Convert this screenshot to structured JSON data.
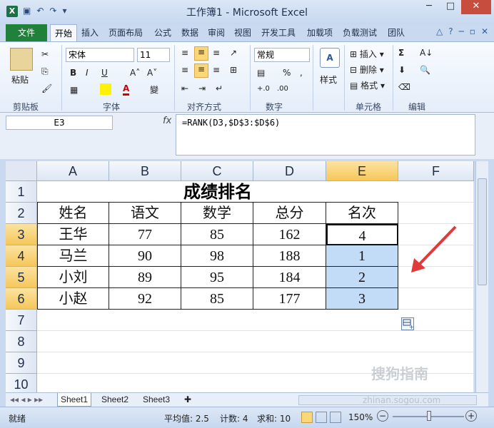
{
  "window": {
    "title": "工作簿1 - Microsoft Excel",
    "app_icon": "X",
    "minimize": "─",
    "restore": "□",
    "close": "✕"
  },
  "qat": {
    "save_icon": "💾",
    "undo_icon": "↶",
    "redo_icon": "↷"
  },
  "ribbon_tabs": [
    "文件",
    "开始",
    "插入",
    "页面布局",
    "公式",
    "数据",
    "审阅",
    "视图",
    "开发工具",
    "加载项",
    "负载测试",
    "团队"
  ],
  "ribbon": {
    "clipboard": {
      "paste": "粘贴",
      "label": "剪贴板"
    },
    "font": {
      "name": "宋体",
      "size": "11",
      "bold": "B",
      "italic": "I",
      "underline": "U",
      "label": "字体"
    },
    "alignment": {
      "label": "对齐方式"
    },
    "number": {
      "format": "常规",
      "percent": "%",
      "comma": ",",
      "label": "数字"
    },
    "styles": {
      "label": "样式"
    },
    "cells": {
      "insert": "插入",
      "delete": "删除",
      "format": "格式",
      "label": "单元格"
    },
    "editing": {
      "sum": "Σ",
      "label": "编辑"
    }
  },
  "formula_bar": {
    "name_box": "E3",
    "fx": "fx",
    "formula": "=RANK(D3,$D$3:$D$6)"
  },
  "sheet": {
    "columns": [
      "A",
      "B",
      "C",
      "D",
      "E",
      "F"
    ],
    "selected_column": "E",
    "rows": [
      "1",
      "2",
      "3",
      "4",
      "5",
      "6",
      "7",
      "8",
      "9",
      "10"
    ],
    "selected_rows": [
      "3",
      "4",
      "5",
      "6"
    ],
    "title": "成绩排名",
    "headers": [
      "姓名",
      "语文",
      "数学",
      "总分",
      "名次"
    ],
    "data": [
      [
        "王华",
        "77",
        "85",
        "162",
        "4"
      ],
      [
        "马兰",
        "90",
        "98",
        "188",
        "1"
      ],
      [
        "小刘",
        "89",
        "95",
        "184",
        "2"
      ],
      [
        "小赵",
        "92",
        "85",
        "177",
        "3"
      ]
    ]
  },
  "sheet_tabs": [
    "Sheet1",
    "Sheet2",
    "Sheet3"
  ],
  "status": {
    "mode": "就绪",
    "average": "平均值: 2.5",
    "count": "计数: 4",
    "sum": "求和: 10",
    "zoom": "150%"
  },
  "watermark": {
    "text": "搜狗指南",
    "url": "zhinan.sogou.com"
  },
  "colors": {
    "selection": "#c2dbf6",
    "header_selected": "#f6c75a",
    "file_tab": "#20813a",
    "arrow": "#e23a3a"
  }
}
